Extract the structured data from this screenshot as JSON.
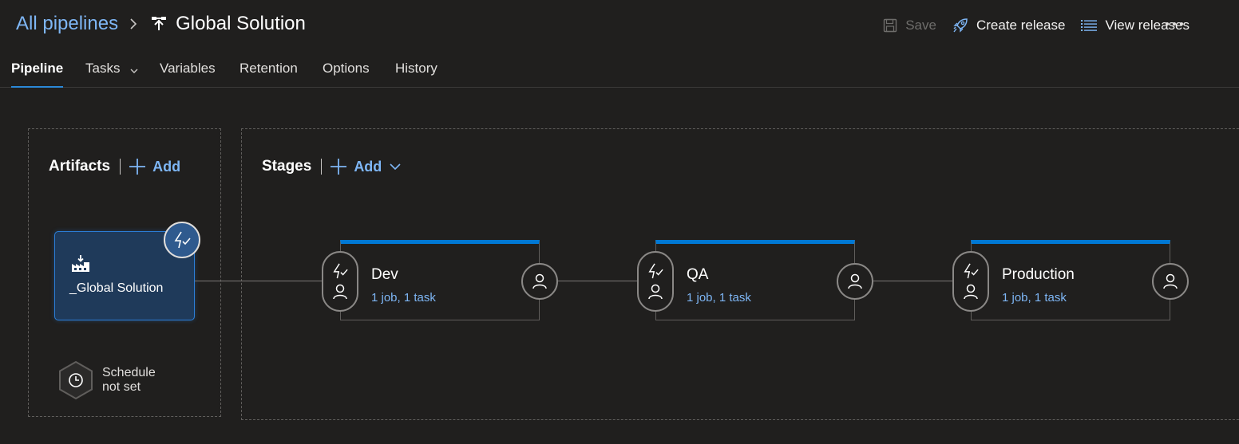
{
  "header": {
    "breadcrumb_root": "All pipelines",
    "pipeline_name": "Global Solution"
  },
  "commands": {
    "save": "Save",
    "create_release": "Create release",
    "view_releases": "View releases"
  },
  "tabs": [
    {
      "label": "Pipeline",
      "active": true
    },
    {
      "label": "Tasks"
    },
    {
      "label": "Variables"
    },
    {
      "label": "Retention"
    },
    {
      "label": "Options"
    },
    {
      "label": "History"
    }
  ],
  "artifacts": {
    "title": "Artifacts",
    "add_label": "Add",
    "items": [
      {
        "name": "_Global Solution"
      }
    ],
    "schedule_line1": "Schedule",
    "schedule_line2": "not set"
  },
  "stages": {
    "title": "Stages",
    "add_label": "Add",
    "items": [
      {
        "name": "Dev",
        "summary": "1 job, 1 task"
      },
      {
        "name": "QA",
        "summary": "1 job, 1 task"
      },
      {
        "name": "Production",
        "summary": "1 job, 1 task"
      }
    ]
  },
  "colors": {
    "background": "#201f1e",
    "link": "#7eb6f5",
    "accent": "#0078d4",
    "artifact_fill": "#1f3a5a"
  },
  "icons": {
    "pipeline": "release-pipeline-icon",
    "save": "save-icon",
    "create_release": "rocket-icon",
    "view_releases": "list-icon",
    "more": "more-icon",
    "add": "plus-icon",
    "trigger": "lightning-icon",
    "approver": "person-icon",
    "schedule": "clock-icon",
    "artifact": "build-artifact-icon"
  }
}
